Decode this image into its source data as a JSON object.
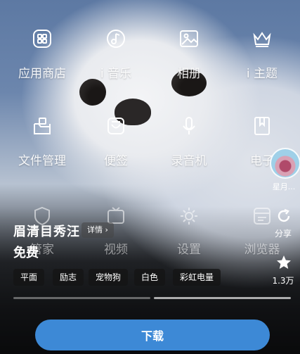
{
  "apps_row1": [
    {
      "label": "应用商店",
      "icon": "app-store-icon"
    },
    {
      "label": "i 音乐",
      "icon": "music-icon"
    },
    {
      "label": "相册",
      "icon": "gallery-icon"
    },
    {
      "label": "i 主题",
      "icon": "theme-icon"
    }
  ],
  "apps_row2": [
    {
      "label": "文件管理",
      "icon": "file-manager-icon"
    },
    {
      "label": "便签",
      "icon": "notes-icon"
    },
    {
      "label": "录音机",
      "icon": "recorder-icon"
    },
    {
      "label": "电子",
      "icon": "ebook-icon"
    }
  ],
  "apps_row3": [
    {
      "label": "管家",
      "icon": "manager-icon"
    },
    {
      "label": "视频",
      "icon": "video-icon"
    },
    {
      "label": "设置",
      "icon": "settings-icon"
    },
    {
      "label": "浏览器",
      "icon": "browser-icon"
    }
  ],
  "sidebar": {
    "author_name": "星月...",
    "share_label": "分享",
    "favorite_count": "1.3万"
  },
  "theme": {
    "title": "眉清目秀汪",
    "detail_label": "详情",
    "price": "免费",
    "tags": [
      "平面",
      "励志",
      "宠物狗",
      "白色",
      "彩虹电量"
    ]
  },
  "preview_pages": {
    "count": 2,
    "current": 2
  },
  "download_label": "下载",
  "colors": {
    "download_button": "#3d89d6"
  }
}
